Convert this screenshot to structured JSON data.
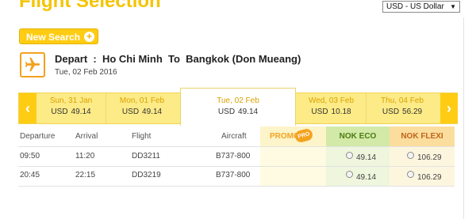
{
  "header": {
    "title": "Flight Selection",
    "currency": "USD - US Dollar"
  },
  "new_search": {
    "label": "New Search",
    "icon": "plus-icon"
  },
  "route": {
    "line": "Depart  :  Ho Chi Minh  To  Bangkok (Don Mueang)",
    "date": "Tue, 02 Feb 2016",
    "icon": "airplane-icon"
  },
  "dates": [
    {
      "label": "Sun, 31 Jan",
      "currency": "USD",
      "price": "49.14"
    },
    {
      "label": "Mon, 01 Feb",
      "currency": "USD",
      "price": "49.14"
    },
    {
      "label": "Tue, 02 Feb",
      "currency": "USD",
      "price": "49.14"
    },
    {
      "label": "Wed, 03 Feb",
      "currency": "USD",
      "price": "10.18"
    },
    {
      "label": "Thu, 04 Feb",
      "currency": "USD",
      "price": "56.29"
    }
  ],
  "table": {
    "headers": {
      "departure": "Departure",
      "arrival": "Arrival",
      "flight": "Flight",
      "aircraft": "Aircraft",
      "promo": "PROMO",
      "promo_badge": "PRO",
      "eco": "NOK ECO",
      "flexi": "NOK FLEXI"
    },
    "rows": [
      {
        "departure": "09:50",
        "arrival": "11:20",
        "flight": "DD3211",
        "aircraft": "B737-800",
        "eco": "49.14",
        "flexi": "106.29"
      },
      {
        "departure": "20:45",
        "arrival": "22:15",
        "flight": "DD3219",
        "aircraft": "B737-800",
        "eco": "49.14",
        "flexi": "106.29"
      }
    ]
  },
  "colors": {
    "accent": "#ffcc14",
    "orange": "#f4a320",
    "eco_green": "#d2e9a8"
  }
}
